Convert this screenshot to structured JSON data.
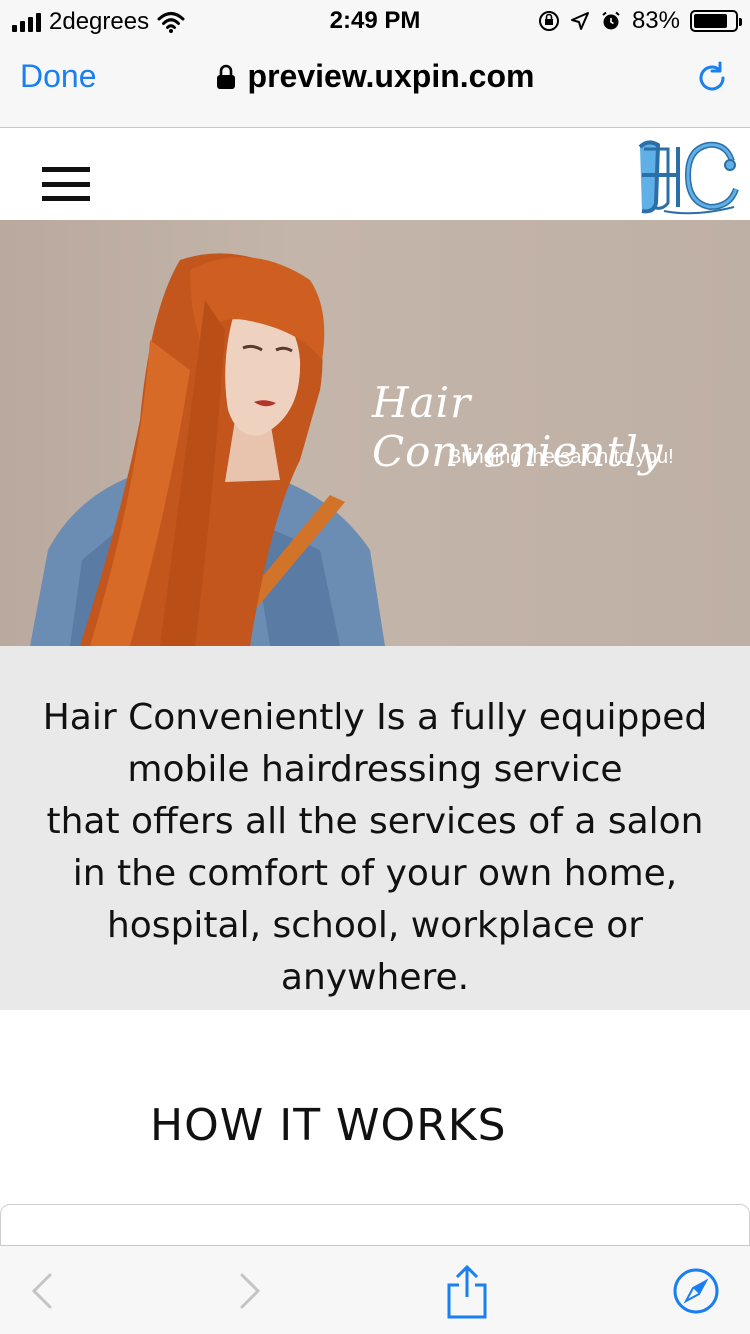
{
  "status_bar": {
    "carrier": "2degrees",
    "time": "2:49 PM",
    "battery_percent": "83%",
    "battery_level": 0.83
  },
  "browser": {
    "done_label": "Done",
    "url": "preview.uxpin.com"
  },
  "site": {
    "logo_text": "HC",
    "hero": {
      "title": "Hair Conveniently",
      "subtitle": "Bringing the salon to you!"
    },
    "intro_lines": [
      "Hair Conveniently Is a fully equipped",
      "mobile hairdressing service",
      "that offers all the services of a salon",
      "in the comfort of your own home,",
      "hospital, school, workplace or",
      "anywhere."
    ],
    "how_it_works": "HOW IT WORKS"
  },
  "colors": {
    "accent": "#1a7ff0",
    "hero_bg": "#c4b5aa",
    "intro_bg": "#e9e9e9",
    "logo_blue": "#3a9ad9"
  }
}
